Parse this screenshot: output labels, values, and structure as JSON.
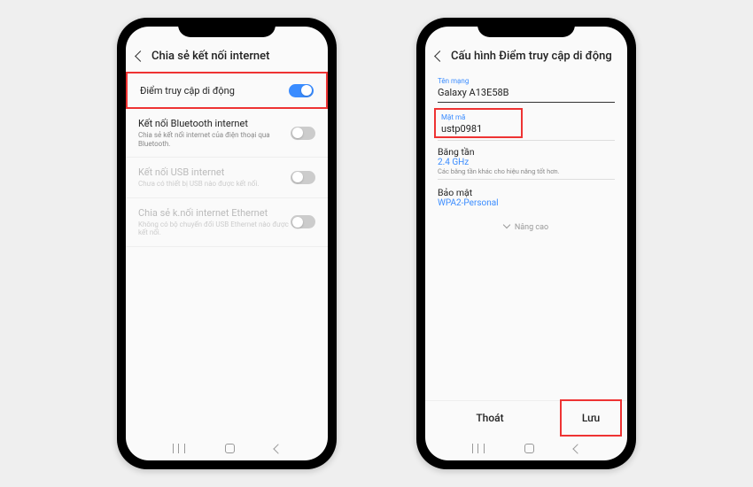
{
  "phone1": {
    "title": "Chia sẻ kết nối internet",
    "rows": [
      {
        "title": "Điểm truy cập di động",
        "sub": "",
        "on": true,
        "highlighted": true,
        "disabled": false
      },
      {
        "title": "Kết nối Bluetooth internet",
        "sub": "Chia sẻ kết nối internet của điện thoại qua Bluetooth.",
        "on": false,
        "highlighted": false,
        "disabled": false
      },
      {
        "title": "Kết nối USB internet",
        "sub": "Chưa có thiết bị USB nào được kết nối.",
        "on": false,
        "highlighted": false,
        "disabled": true
      },
      {
        "title": "Chia sẻ k.nối internet Ethernet",
        "sub": "Không có bộ chuyển đổi USB Ethernet nào được kết nối.",
        "on": false,
        "highlighted": false,
        "disabled": true
      }
    ]
  },
  "phone2": {
    "title": "Cấu hình Điểm truy cập di động",
    "network_label": "Tên mạng",
    "network_value": "Galaxy A13E58B",
    "password_label": "Mật mã",
    "password_value": "ustp0981",
    "band_label": "Băng tần",
    "band_value": "2.4 GHz",
    "band_sub": "Các băng tần khác cho hiệu năng tốt hơn.",
    "security_label": "Bảo mật",
    "security_value": "WPA2-Personal",
    "advanced": "Nâng cao",
    "exit": "Thoát",
    "save": "Lưu"
  }
}
